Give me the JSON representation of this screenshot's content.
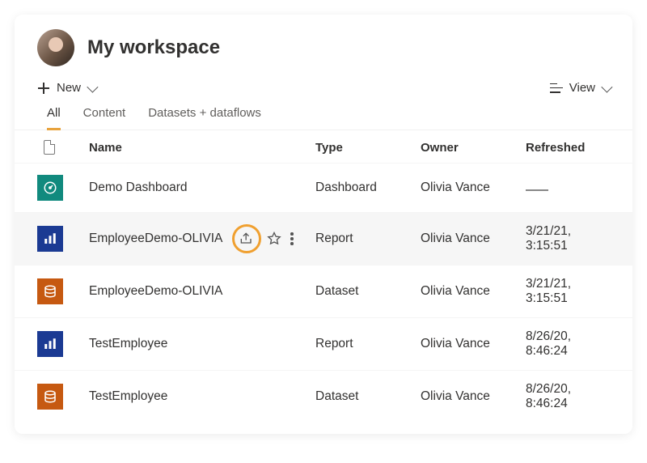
{
  "header": {
    "title": "My workspace"
  },
  "toolbar": {
    "new_label": "New",
    "view_label": "View"
  },
  "tabs": [
    {
      "label": "All",
      "active": true
    },
    {
      "label": "Content",
      "active": false
    },
    {
      "label": "Datasets + dataflows",
      "active": false
    }
  ],
  "columns": {
    "name": "Name",
    "type": "Type",
    "owner": "Owner",
    "refreshed": "Refreshed"
  },
  "rows": [
    {
      "icon": "dashboard",
      "name": "Demo Dashboard",
      "type": "Dashboard",
      "owner": "Olivia Vance",
      "refreshed": "—",
      "refreshed_dash": true
    },
    {
      "icon": "report",
      "name": "EmployeeDemo-OLIVIA",
      "type": "Report",
      "owner": "Olivia Vance",
      "refreshed": "3/21/21, 3:15:51",
      "hover": true,
      "actions": true
    },
    {
      "icon": "dataset",
      "name": "EmployeeDemo-OLIVIA",
      "type": "Dataset",
      "owner": "Olivia Vance",
      "refreshed": "3/21/21, 3:15:51"
    },
    {
      "icon": "report",
      "name": "TestEmployee",
      "type": "Report",
      "owner": "Olivia Vance",
      "refreshed": "8/26/20, 8:46:24"
    },
    {
      "icon": "dataset",
      "name": "TestEmployee",
      "type": "Dataset",
      "owner": "Olivia Vance",
      "refreshed": "8/26/20, 8:46:24"
    }
  ]
}
